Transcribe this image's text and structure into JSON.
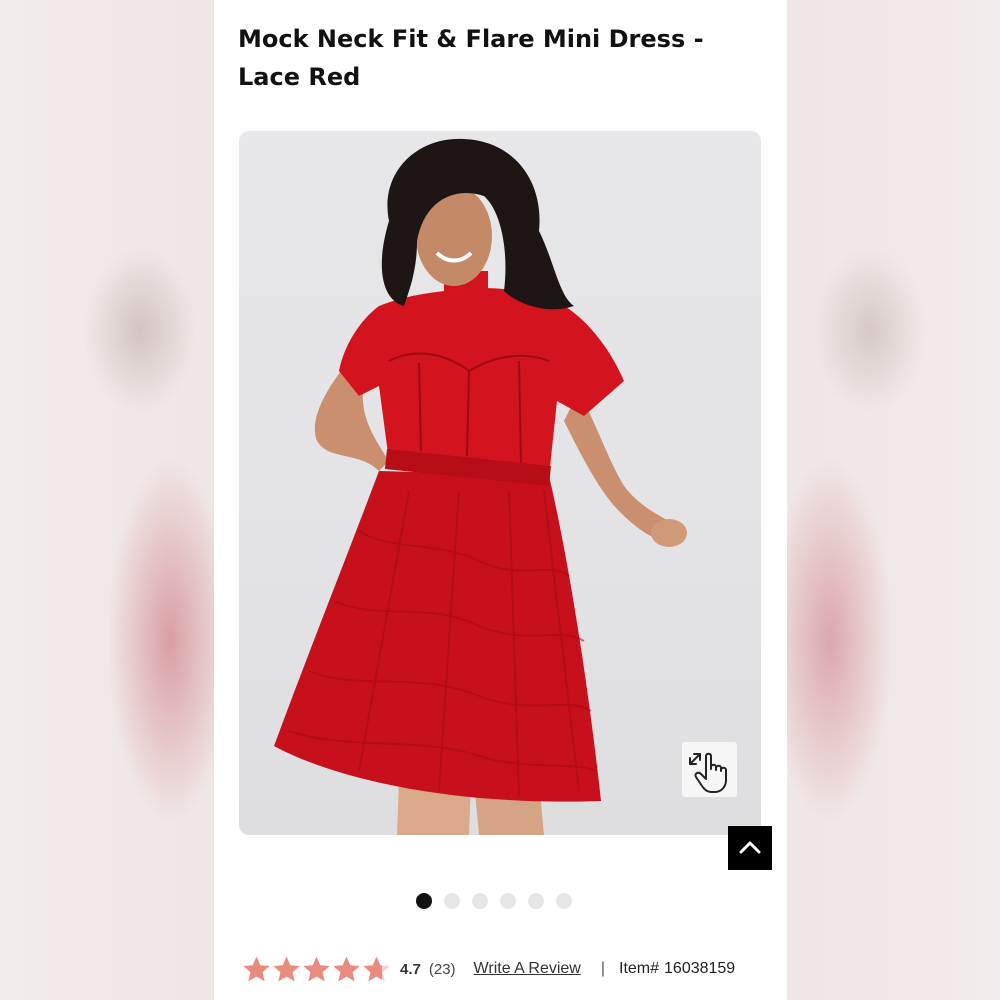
{
  "product": {
    "title": "Mock Neck Fit & Flare Mini Dress - Lace Red"
  },
  "gallery": {
    "image_alt": "Model wearing red lace fit and flare mini dress",
    "zoom_icon": "tap-to-zoom-icon",
    "back_to_top_icon": "chevron-up-icon",
    "slide_count": 6,
    "active_slide": 1
  },
  "rating": {
    "score": "4.7",
    "count": "(23)",
    "stars_filled": 4.7,
    "star_color": "#ea8b80",
    "write_review_label": "Write A Review",
    "separator": "|",
    "item_label": "Item#",
    "item_number": "16038159"
  }
}
